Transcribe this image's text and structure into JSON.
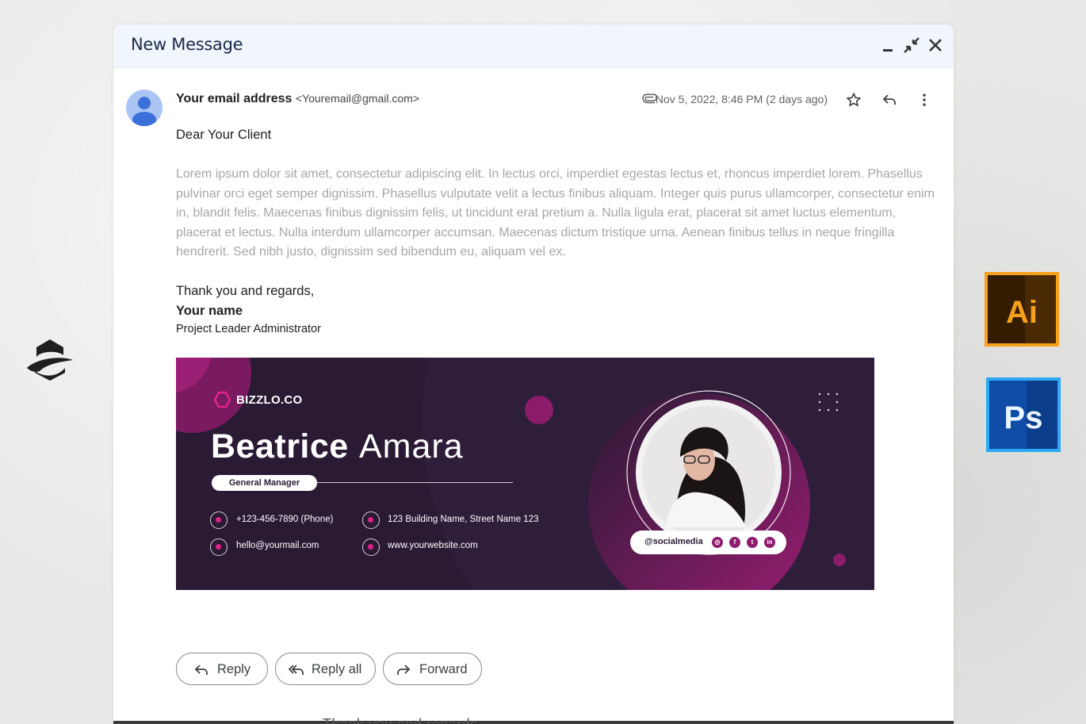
{
  "window": {
    "title": "New Message"
  },
  "email": {
    "sender_name": "Your email address",
    "sender_address": "<Youremail@gmail.com>",
    "date": "Nov 5, 2022, 8:46 PM (2 days ago)",
    "greeting": "Dear Your Client",
    "body": "Lorem ipsum dolor sit amet, consectetur adipiscing elit. In lectus orci, imperdiet egestas lectus et, rhoncus imperdiet lorem. Phasellus pulvinar orci eget semper dignissim. Phasellus vulputate velit a lectus finibus aliquam. Integer quis purus ullamcorper, consectetur enim in, blandit felis. Maecenas finibus dignissim felis, ut tincidunt erat pretium a. Nulla ligula erat, placerat sit amet luctus elementum, placerat et lectus. Nulla interdum ullamcorper accumsan. Maecenas dictum tristique urna. Aenean finibus tellus in neque fringilla hendrerit. Sed nibh justo, dignissim sed bibendum eu, aliquam vel ex.",
    "closing": "Thank you and regards,",
    "signature_name": "Your name",
    "signature_title": "Project Leader Administrator"
  },
  "banner": {
    "brand": "BIZZLO.CO",
    "first_name": "Beatrice",
    "last_name": "Amara",
    "role": "General Manager",
    "phone": "+123-456-7890 (Phone)",
    "address": "123 Building Name, Street Name 123",
    "email": "hello@yourmail.com",
    "website": "www.yourwebsite.com",
    "social": "@socialmedia",
    "accent_color": "#e0248a",
    "background_color": "#2a1a34"
  },
  "actions": {
    "reply": "Reply",
    "reply_all": "Reply all",
    "forward": "Forward"
  },
  "overflow_text": "Thank you and regards,",
  "badges": {
    "illustrator": "Ai",
    "photoshop": "Ps"
  }
}
